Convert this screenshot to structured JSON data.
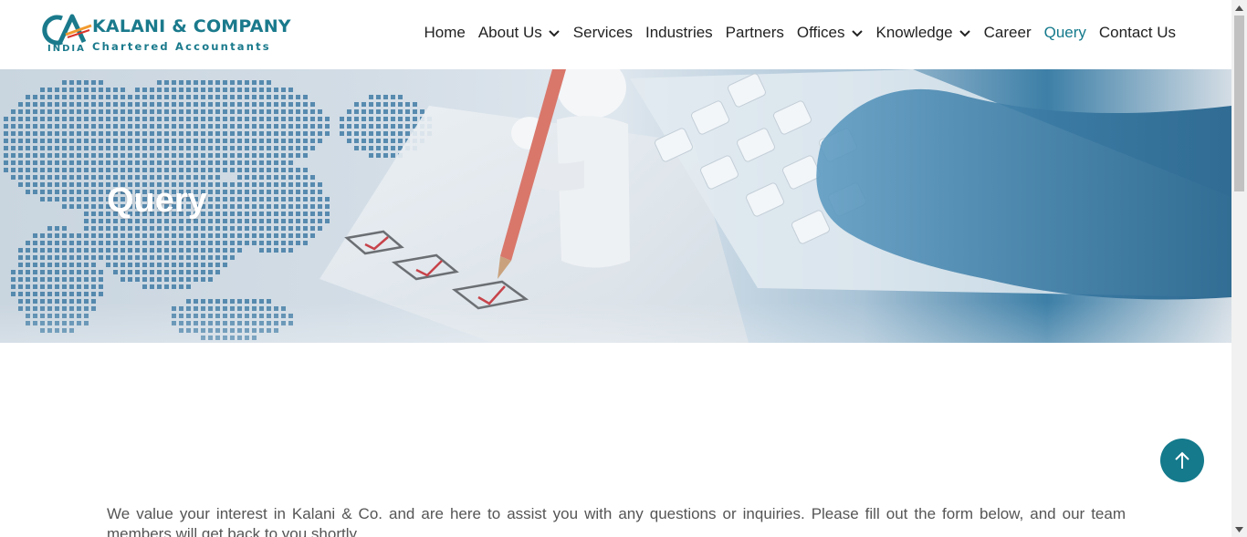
{
  "brand": {
    "mark": "CA",
    "name": "KALANI & COMPANY",
    "subtitle": "Chartered Accountants",
    "country": "INDIA",
    "colors": {
      "primary": "#1a7a8c",
      "mark_orange": "#f29a2e",
      "mark_red": "#d9342b"
    }
  },
  "nav": {
    "items": [
      {
        "label": "Home",
        "dropdown": false,
        "active": false
      },
      {
        "label": "About Us",
        "dropdown": true,
        "active": false
      },
      {
        "label": "Services",
        "dropdown": false,
        "active": false
      },
      {
        "label": "Industries",
        "dropdown": false,
        "active": false
      },
      {
        "label": "Partners",
        "dropdown": false,
        "active": false
      },
      {
        "label": "Offices",
        "dropdown": true,
        "active": false
      },
      {
        "label": "Knowledge",
        "dropdown": true,
        "active": false
      },
      {
        "label": "Career",
        "dropdown": false,
        "active": false
      },
      {
        "label": "Query",
        "dropdown": false,
        "active": true
      },
      {
        "label": "Contact Us",
        "dropdown": false,
        "active": false
      }
    ],
    "active_color": "#147a8c"
  },
  "hero": {
    "title": "Query",
    "image": "illustration of figure with pencil ticking checkboxes beside keyboard and hand"
  },
  "content": {
    "intro": "We value your interest in Kalani & Co. and are here to assist you with any questions or inquiries. Please fill out the form below, and our team members will get back to you shortly."
  },
  "back_to_top": {
    "icon": "arrow-up-icon",
    "color": "#147a8c"
  },
  "scrollbar": {
    "icons": [
      "scroll-up-arrow-icon",
      "scroll-down-arrow-icon"
    ]
  }
}
